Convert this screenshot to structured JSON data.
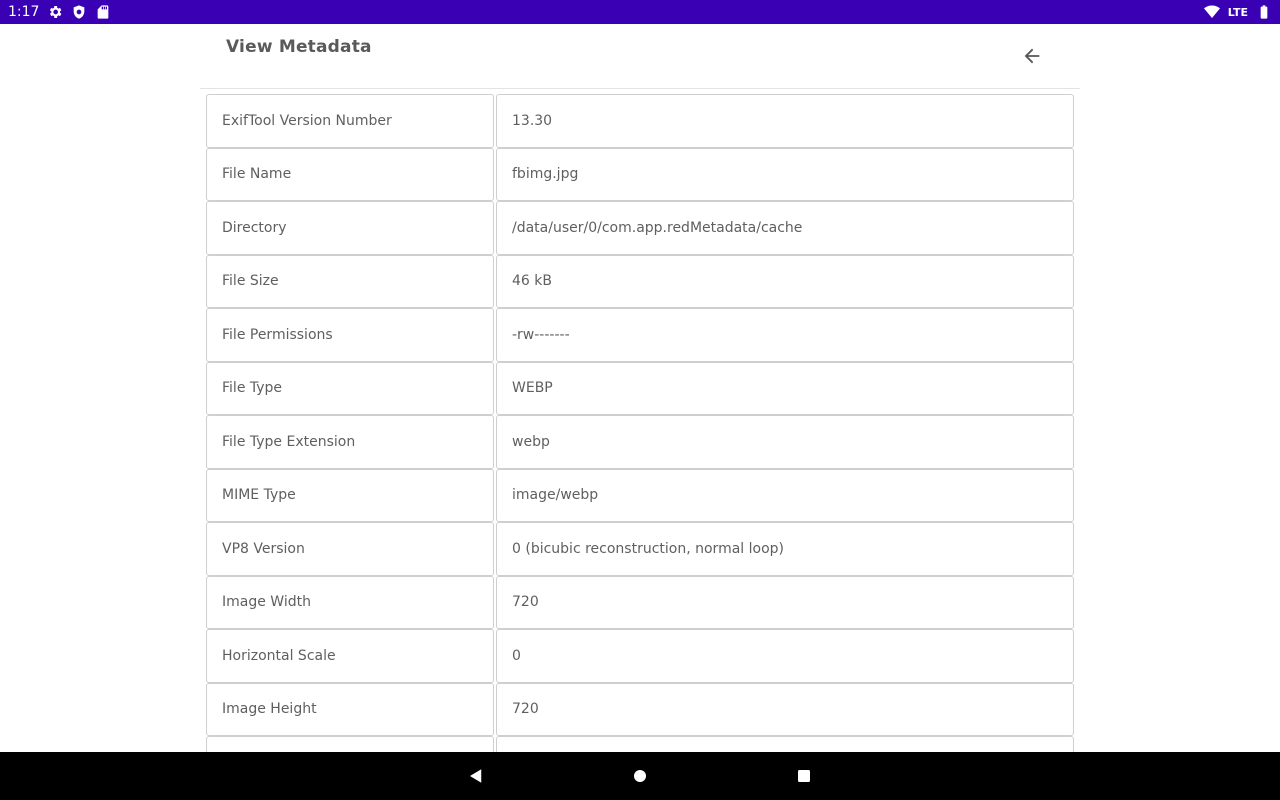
{
  "status_bar": {
    "time": "1:17",
    "network": "LTE",
    "icons": [
      "settings-icon",
      "shield-icon",
      "sd-card-icon",
      "wifi-icon",
      "battery-icon"
    ]
  },
  "header": {
    "title": "View Metadata",
    "back_icon": "arrow-left-icon"
  },
  "metadata": [
    {
      "key": "ExifTool Version Number",
      "value": "13.30"
    },
    {
      "key": "File Name",
      "value": "fbimg.jpg"
    },
    {
      "key": "Directory",
      "value": "/data/user/0/com.app.redMetadata/cache"
    },
    {
      "key": "File Size",
      "value": "46 kB"
    },
    {
      "key": "File Permissions",
      "value": "-rw-------"
    },
    {
      "key": "File Type",
      "value": "WEBP"
    },
    {
      "key": "File Type Extension",
      "value": "webp"
    },
    {
      "key": "MIME Type",
      "value": "image/webp"
    },
    {
      "key": "VP8 Version",
      "value": "0 (bicubic reconstruction, normal loop)"
    },
    {
      "key": "Image Width",
      "value": "720"
    },
    {
      "key": "Horizontal Scale",
      "value": "0"
    },
    {
      "key": "Image Height",
      "value": "720"
    },
    {
      "key": "",
      "value": ""
    }
  ],
  "nav_bar": {
    "buttons": [
      "back-triangle-icon",
      "home-circle-icon",
      "recents-square-icon"
    ]
  }
}
